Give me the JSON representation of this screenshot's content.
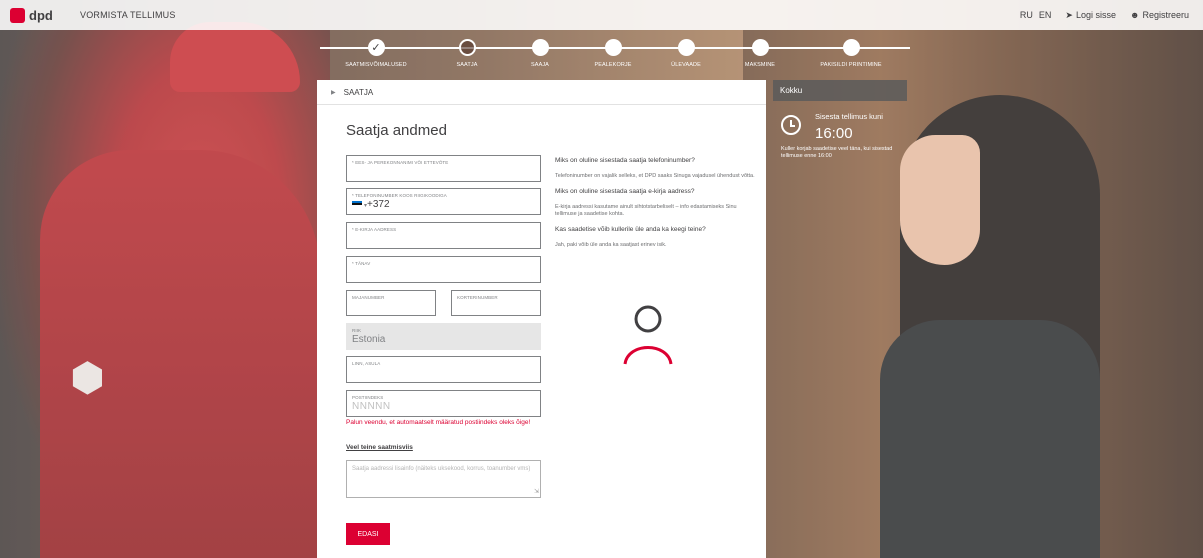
{
  "topbar": {
    "brand": "dpd",
    "title": "VORMISTA TELLIMUS",
    "lang_ru": "RU",
    "lang_en": "EN",
    "login": "Logi sisse",
    "register": "Registreeru"
  },
  "steps": [
    {
      "label": "SAATMISVÕIMALUSED",
      "state": "done"
    },
    {
      "label": "SAATJA",
      "state": "current"
    },
    {
      "label": "SAAJA",
      "state": "todo"
    },
    {
      "label": "PEALEKORJE",
      "state": "todo"
    },
    {
      "label": "ÜLEVAADE",
      "state": "todo"
    },
    {
      "label": "MAKSMINE",
      "state": "todo"
    },
    {
      "label": "PAKISILDI PRINTIMINE",
      "state": "todo"
    }
  ],
  "panel": {
    "section": "SAATJA",
    "title": "Saatja andmed"
  },
  "fields": {
    "name": {
      "label": "* EES- JA PEREKONNANIMI VÕI ETTEVÕTE",
      "value": ""
    },
    "phone": {
      "label": "* TELEFONINUMBER KOOS RIIGIKOODIGA",
      "value": "+372"
    },
    "email": {
      "label": "* E-KIRJA AADRESS",
      "value": ""
    },
    "street": {
      "label": "* TÄNAV",
      "value": ""
    },
    "house": {
      "label": "MAJANUMBER",
      "value": ""
    },
    "apartment": {
      "label": "KORTERINUMBER",
      "value": ""
    },
    "country": {
      "label": "RIIK",
      "value": "Estonia"
    },
    "city": {
      "label": "LINN, ASULA",
      "value": ""
    },
    "postcode": {
      "label": "POSTIINDEKS",
      "placeholder": "NNNNN"
    }
  },
  "postcode_error": "Palun veendu, et automaatselt määratud postiindeks oleks õige!",
  "more_details_link": "Veel teine saatmisviis",
  "notes_placeholder": "Saatja aadressi lisainfo (näiteks uksekood, korrus, toanumber vms)",
  "next_button": "EDASI",
  "help": [
    {
      "q": "Miks on oluline sisestada saatja telefoninumber?",
      "a": "Telefoninumber on vajalik selleks, et DPD saaks Sinuga vajadusel ühendust võtta."
    },
    {
      "q": "Miks on oluline sisestada saatja e-kirja aadress?",
      "a": "E-kirja aadressi kasutame ainult sihtotstarbeliselt – info edastamiseks Sinu tellimuse ja saadetise kohta."
    },
    {
      "q": "Kas saadetise võib kullerile üle anda ka keegi teine?",
      "a": "Jah, paki võib üle anda ka saatjast erinev isik."
    }
  ],
  "summary": {
    "title": "Kokku",
    "deadline_label": "Sisesta tellimus kuni",
    "deadline_time": "16:00",
    "deadline_note": "Kuller korjab saadetise veel täna, kui sisestad tellimuse enne 16:00"
  },
  "colors": {
    "accent": "#dc0032",
    "text": "#414042"
  }
}
